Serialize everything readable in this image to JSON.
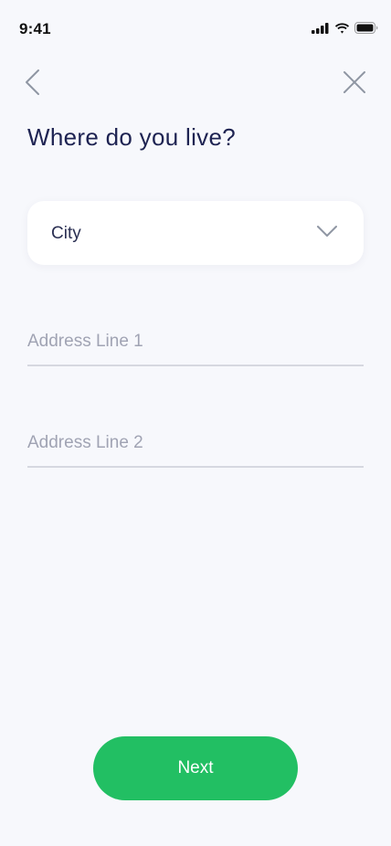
{
  "status_bar": {
    "time": "9:41",
    "icons": [
      "signal-icon",
      "wifi-icon",
      "battery-icon"
    ]
  },
  "nav": {
    "back_icon": "chevron-left-icon",
    "close_icon": "close-icon"
  },
  "title": "Where do you live?",
  "city_select": {
    "label": "City",
    "icon": "chevron-down-icon"
  },
  "address_line_1": {
    "value": "",
    "placeholder": "Address Line 1"
  },
  "address_line_2": {
    "value": "",
    "placeholder": "Address Line 2"
  },
  "next_button": {
    "label": "Next"
  },
  "colors": {
    "background": "#f7f8fc",
    "title": "#1e2352",
    "accent": "#22bf63",
    "divider": "#d6d8e0",
    "placeholder": "#a0a3b3"
  }
}
